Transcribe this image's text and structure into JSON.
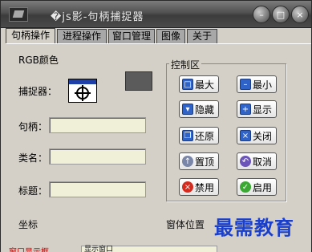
{
  "window": {
    "title": "�js影-句柄捕捉器"
  },
  "tabs": [
    "句柄操作",
    "进程操作",
    "窗口管理",
    "图像",
    "关于"
  ],
  "panel": {
    "rgb_label": "RGB颜色",
    "capturer_label": "捕捉器：",
    "handle_label": "句柄：",
    "class_label": "类名：",
    "caption_label": "标题：",
    "handle_value": "",
    "class_value": "",
    "caption_value": "",
    "swatch_color": "#5b5b5b"
  },
  "control": {
    "title": "控制区",
    "buttons": [
      {
        "label": "最大",
        "icon": "maximize-icon"
      },
      {
        "label": "最小",
        "icon": "minimize-icon"
      },
      {
        "label": "隐藏",
        "icon": "hide-icon"
      },
      {
        "label": "显示",
        "icon": "show-icon"
      },
      {
        "label": "还原",
        "icon": "restore-icon"
      },
      {
        "label": "关闭",
        "icon": "close-icon"
      },
      {
        "label": "置顶",
        "icon": "pin-top-icon"
      },
      {
        "label": "取消",
        "icon": "cancel-icon"
      },
      {
        "label": "禁用",
        "icon": "disable-icon"
      },
      {
        "label": "启用",
        "icon": "enable-icon"
      }
    ]
  },
  "footer": {
    "coord_label": "坐标",
    "window_pos_label": "窗体位置",
    "bottom_left": "窗口显示框",
    "bottom_box": "显示窗口"
  },
  "watermark": "最需教育"
}
